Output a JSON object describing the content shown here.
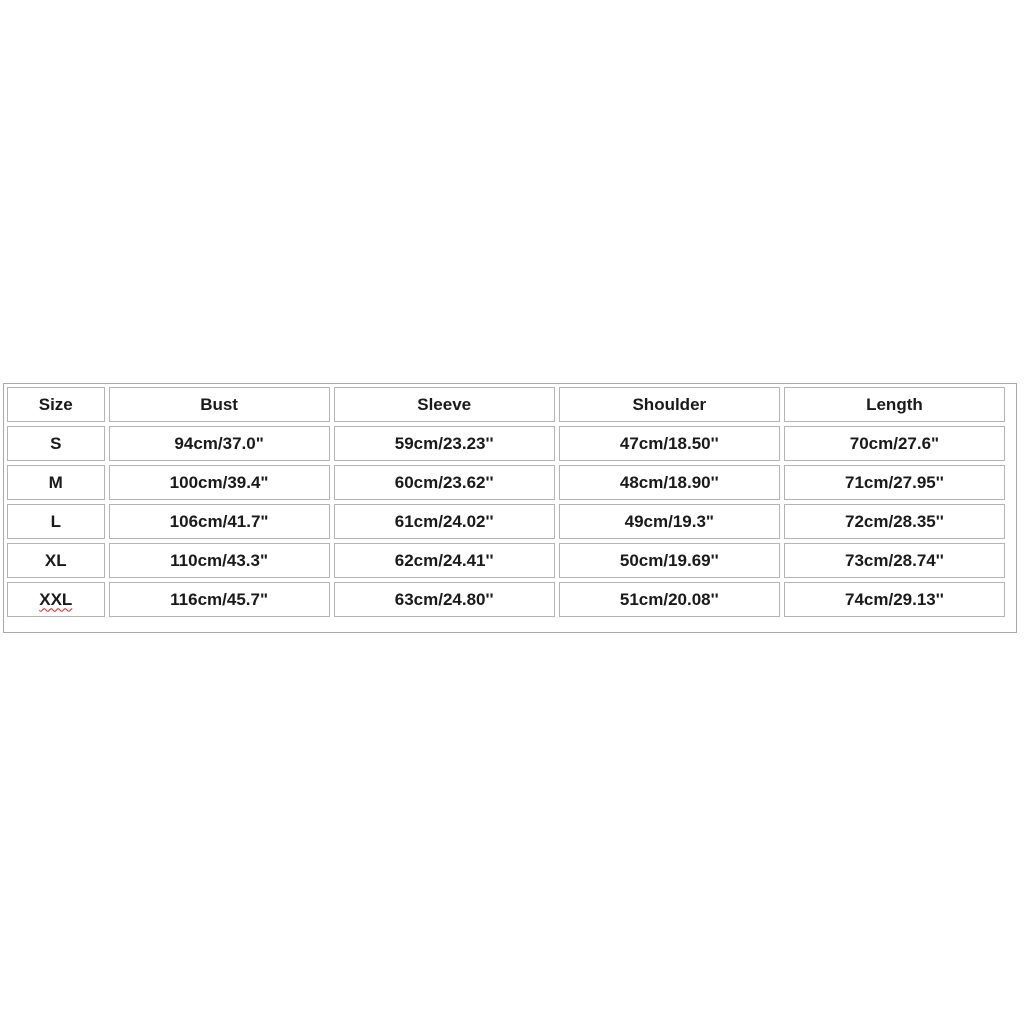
{
  "size_chart": {
    "headers": [
      "Size",
      "Bust",
      "Sleeve",
      "Shoulder",
      "Length"
    ],
    "rows": [
      {
        "size": "S",
        "bust": "94cm/37.0\"",
        "sleeve": "59cm/23.23''",
        "shoulder": "47cm/18.50''",
        "length": "70cm/27.6\""
      },
      {
        "size": "M",
        "bust": "100cm/39.4\"",
        "sleeve": "60cm/23.62''",
        "shoulder": "48cm/18.90''",
        "length": "71cm/27.95''"
      },
      {
        "size": "L",
        "bust": "106cm/41.7\"",
        "sleeve": "61cm/24.02''",
        "shoulder": "49cm/19.3\"",
        "length": "72cm/28.35''"
      },
      {
        "size": "XL",
        "bust": "110cm/43.3\"",
        "sleeve": "62cm/24.41''",
        "shoulder": "50cm/19.69''",
        "length": "73cm/28.74''"
      },
      {
        "size": "XXL",
        "bust": "116cm/45.7\"",
        "sleeve": "63cm/24.80''",
        "shoulder": "51cm/20.08''",
        "length": "74cm/29.13''"
      }
    ]
  }
}
